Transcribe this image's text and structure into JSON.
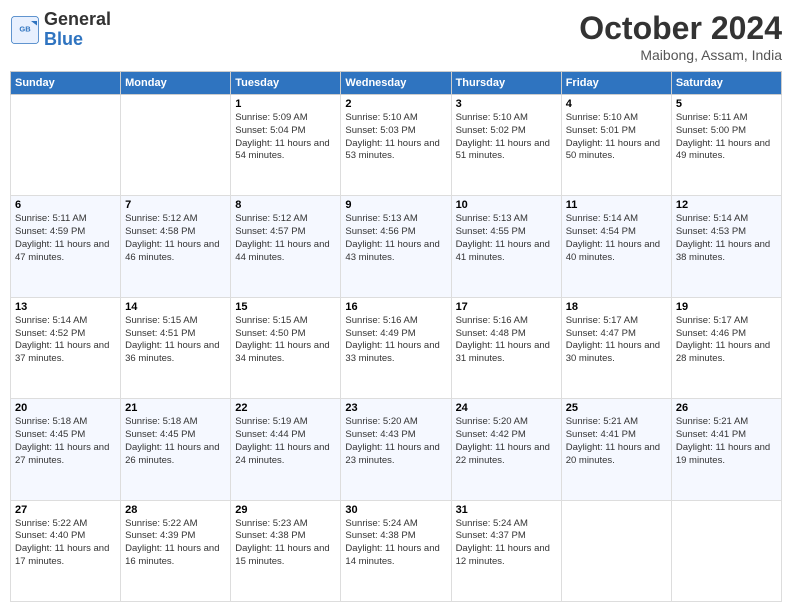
{
  "header": {
    "logo_line1": "General",
    "logo_line2": "Blue",
    "month": "October 2024",
    "location": "Maibong, Assam, India"
  },
  "days_of_week": [
    "Sunday",
    "Monday",
    "Tuesday",
    "Wednesday",
    "Thursday",
    "Friday",
    "Saturday"
  ],
  "weeks": [
    [
      {
        "day": "",
        "info": ""
      },
      {
        "day": "",
        "info": ""
      },
      {
        "day": "1",
        "info": "Sunrise: 5:09 AM\nSunset: 5:04 PM\nDaylight: 11 hours and 54 minutes."
      },
      {
        "day": "2",
        "info": "Sunrise: 5:10 AM\nSunset: 5:03 PM\nDaylight: 11 hours and 53 minutes."
      },
      {
        "day": "3",
        "info": "Sunrise: 5:10 AM\nSunset: 5:02 PM\nDaylight: 11 hours and 51 minutes."
      },
      {
        "day": "4",
        "info": "Sunrise: 5:10 AM\nSunset: 5:01 PM\nDaylight: 11 hours and 50 minutes."
      },
      {
        "day": "5",
        "info": "Sunrise: 5:11 AM\nSunset: 5:00 PM\nDaylight: 11 hours and 49 minutes."
      }
    ],
    [
      {
        "day": "6",
        "info": "Sunrise: 5:11 AM\nSunset: 4:59 PM\nDaylight: 11 hours and 47 minutes."
      },
      {
        "day": "7",
        "info": "Sunrise: 5:12 AM\nSunset: 4:58 PM\nDaylight: 11 hours and 46 minutes."
      },
      {
        "day": "8",
        "info": "Sunrise: 5:12 AM\nSunset: 4:57 PM\nDaylight: 11 hours and 44 minutes."
      },
      {
        "day": "9",
        "info": "Sunrise: 5:13 AM\nSunset: 4:56 PM\nDaylight: 11 hours and 43 minutes."
      },
      {
        "day": "10",
        "info": "Sunrise: 5:13 AM\nSunset: 4:55 PM\nDaylight: 11 hours and 41 minutes."
      },
      {
        "day": "11",
        "info": "Sunrise: 5:14 AM\nSunset: 4:54 PM\nDaylight: 11 hours and 40 minutes."
      },
      {
        "day": "12",
        "info": "Sunrise: 5:14 AM\nSunset: 4:53 PM\nDaylight: 11 hours and 38 minutes."
      }
    ],
    [
      {
        "day": "13",
        "info": "Sunrise: 5:14 AM\nSunset: 4:52 PM\nDaylight: 11 hours and 37 minutes."
      },
      {
        "day": "14",
        "info": "Sunrise: 5:15 AM\nSunset: 4:51 PM\nDaylight: 11 hours and 36 minutes."
      },
      {
        "day": "15",
        "info": "Sunrise: 5:15 AM\nSunset: 4:50 PM\nDaylight: 11 hours and 34 minutes."
      },
      {
        "day": "16",
        "info": "Sunrise: 5:16 AM\nSunset: 4:49 PM\nDaylight: 11 hours and 33 minutes."
      },
      {
        "day": "17",
        "info": "Sunrise: 5:16 AM\nSunset: 4:48 PM\nDaylight: 11 hours and 31 minutes."
      },
      {
        "day": "18",
        "info": "Sunrise: 5:17 AM\nSunset: 4:47 PM\nDaylight: 11 hours and 30 minutes."
      },
      {
        "day": "19",
        "info": "Sunrise: 5:17 AM\nSunset: 4:46 PM\nDaylight: 11 hours and 28 minutes."
      }
    ],
    [
      {
        "day": "20",
        "info": "Sunrise: 5:18 AM\nSunset: 4:45 PM\nDaylight: 11 hours and 27 minutes."
      },
      {
        "day": "21",
        "info": "Sunrise: 5:18 AM\nSunset: 4:45 PM\nDaylight: 11 hours and 26 minutes."
      },
      {
        "day": "22",
        "info": "Sunrise: 5:19 AM\nSunset: 4:44 PM\nDaylight: 11 hours and 24 minutes."
      },
      {
        "day": "23",
        "info": "Sunrise: 5:20 AM\nSunset: 4:43 PM\nDaylight: 11 hours and 23 minutes."
      },
      {
        "day": "24",
        "info": "Sunrise: 5:20 AM\nSunset: 4:42 PM\nDaylight: 11 hours and 22 minutes."
      },
      {
        "day": "25",
        "info": "Sunrise: 5:21 AM\nSunset: 4:41 PM\nDaylight: 11 hours and 20 minutes."
      },
      {
        "day": "26",
        "info": "Sunrise: 5:21 AM\nSunset: 4:41 PM\nDaylight: 11 hours and 19 minutes."
      }
    ],
    [
      {
        "day": "27",
        "info": "Sunrise: 5:22 AM\nSunset: 4:40 PM\nDaylight: 11 hours and 17 minutes."
      },
      {
        "day": "28",
        "info": "Sunrise: 5:22 AM\nSunset: 4:39 PM\nDaylight: 11 hours and 16 minutes."
      },
      {
        "day": "29",
        "info": "Sunrise: 5:23 AM\nSunset: 4:38 PM\nDaylight: 11 hours and 15 minutes."
      },
      {
        "day": "30",
        "info": "Sunrise: 5:24 AM\nSunset: 4:38 PM\nDaylight: 11 hours and 14 minutes."
      },
      {
        "day": "31",
        "info": "Sunrise: 5:24 AM\nSunset: 4:37 PM\nDaylight: 11 hours and 12 minutes."
      },
      {
        "day": "",
        "info": ""
      },
      {
        "day": "",
        "info": ""
      }
    ]
  ]
}
